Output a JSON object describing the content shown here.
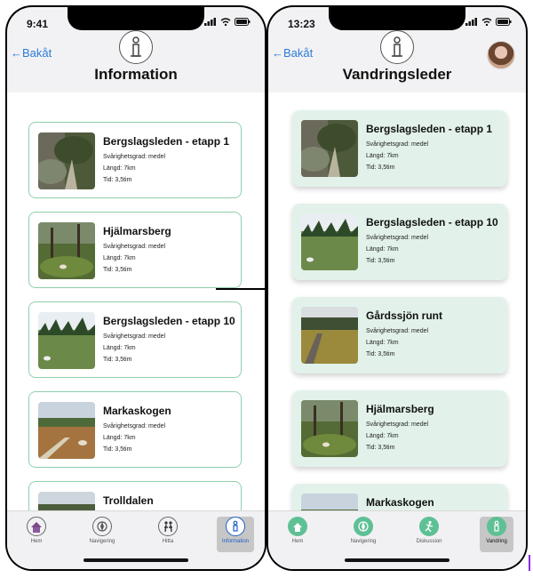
{
  "colors": {
    "accent_link": "#2e7bd6",
    "card_border_left": "#8fcfae",
    "card_bg_right": "#e2f2ea",
    "tab_active_label": "#1d5fc4",
    "tab_icon_green": "#5ec095"
  },
  "left": {
    "status_time": "9:41",
    "back_label": "←Bakåt",
    "info_icon_letter": "i",
    "title": "Information",
    "cards": [
      {
        "title": "Bergslagsleden - etapp 1",
        "difficulty": "Svårighetsgrad: medel",
        "length": "Längd: 7km",
        "time": "Tid: 3,5tim"
      },
      {
        "title": "Hjälmarsberg",
        "difficulty": "Svårighetsgrad: medel",
        "length": "Längd: 7km",
        "time": "Tid: 3,5tim"
      },
      {
        "title": "Bergslagsleden - etapp 10",
        "difficulty": "Svårighetsgrad: medel",
        "length": "Längd: 7km",
        "time": "Tid: 3,5tim"
      },
      {
        "title": "Markaskogen",
        "difficulty": "Svårighetsgrad: medel",
        "length": "Längd: 7km",
        "time": "Tid: 3,5tim"
      },
      {
        "title": "Trolldalen",
        "difficulty": "",
        "length": "",
        "time": ""
      }
    ],
    "tabs": [
      {
        "label": "Hem",
        "icon": "home-icon"
      },
      {
        "label": "Navigering",
        "icon": "compass-icon"
      },
      {
        "label": "Hitta",
        "icon": "hikers-icon"
      },
      {
        "label": "Information",
        "icon": "info-icon",
        "active": true
      }
    ]
  },
  "right": {
    "status_time": "13:23",
    "back_label": "←Bakåt",
    "info_icon_letter": "i",
    "title": "Vandringsleder",
    "cards": [
      {
        "title": "Bergslagsleden - etapp 1",
        "difficulty": "Svårighetsgrad: medel",
        "length": "Längd: 7km",
        "time": "Tid: 3,5tim"
      },
      {
        "title": "Bergslagsleden - etapp 10",
        "difficulty": "Svårighetsgrad: medel",
        "length": "Längd: 7km",
        "time": "Tid: 3,5tim"
      },
      {
        "title": "Gårdssjön runt",
        "difficulty": "Svårighetsgrad: medel",
        "length": "Längd: 7km",
        "time": "Tid: 3,5tim"
      },
      {
        "title": "Hjälmarsberg",
        "difficulty": "Svårighetsgrad: medel",
        "length": "Längd: 7km",
        "time": "Tid: 3,5tim"
      },
      {
        "title": "Markaskogen",
        "difficulty": "",
        "length": "",
        "time": ""
      }
    ],
    "tabs": [
      {
        "label": "Hem",
        "icon": "home-icon"
      },
      {
        "label": "Navigering",
        "icon": "compass-icon"
      },
      {
        "label": "Diskussion",
        "icon": "runner-icon"
      },
      {
        "label": "Vandring",
        "icon": "info-icon",
        "active": true
      }
    ]
  }
}
